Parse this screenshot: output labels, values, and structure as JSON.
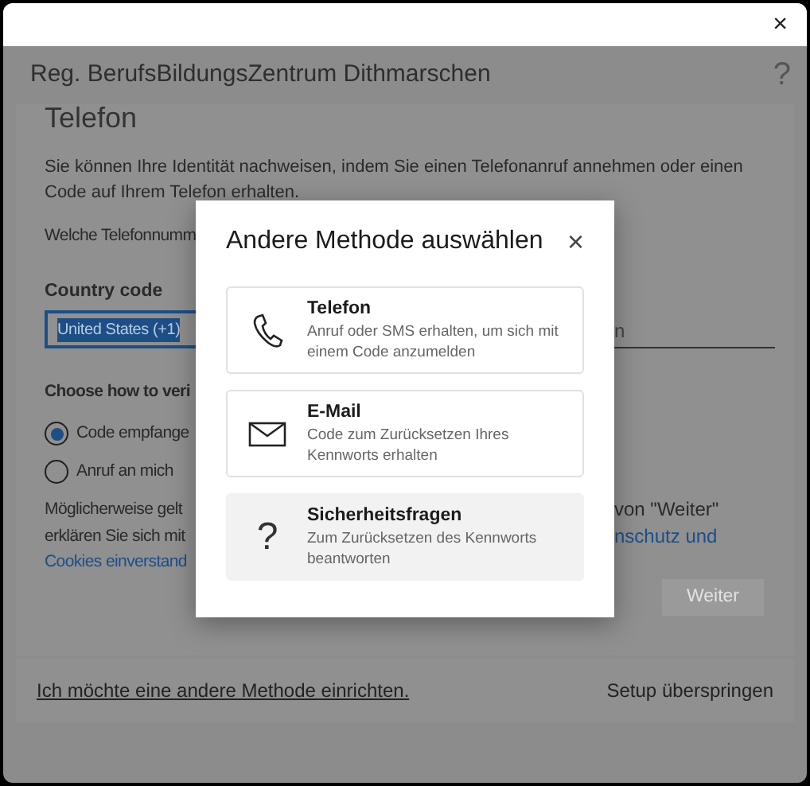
{
  "window": {
    "close": "×",
    "title": "Reg. BerufsBildungsZentrum Dithmarschen",
    "help": "?"
  },
  "page": {
    "heading": "Telefon",
    "intro": "Sie können Ihre Identität nachweisen, indem Sie einen Telefonanruf annehmen oder einen Code auf Ihrem Telefon erhalten.",
    "question": "Welche Telefonnumm",
    "country_label": "Country code",
    "country_value": "United States (+1)",
    "phone_placeholder": "n",
    "method_label": "Choose how to veri",
    "methods": [
      {
        "label": "Code empfange",
        "selected": true
      },
      {
        "label": "Anruf an mich",
        "selected": false
      }
    ],
    "notice_left": [
      {
        "text": "Möglicherweise gelt",
        "kind": "text"
      },
      {
        "text": "erklären Sie sich mit",
        "kind": "text"
      },
      {
        "text": "Cookies einverstand",
        "kind": "link"
      }
    ],
    "notice_right": [
      {
        "text": "von \"Weiter\"",
        "kind": "text"
      },
      {
        "text": "nschutz und",
        "kind": "link"
      }
    ],
    "next_button": {
      "label": "Weiter",
      "disabled": true
    }
  },
  "footer": {
    "link": "Ich möchte eine andere Methode einrichten.",
    "skip": "Setup überspringen"
  },
  "dialog": {
    "title": "Andere Methode auswählen",
    "close": "×",
    "options": [
      {
        "kind": "phone",
        "title": "Telefon",
        "description": "Anruf oder SMS erhalten, um sich mit einem Code anzumelden",
        "selected": false
      },
      {
        "kind": "email",
        "title": "E-Mail",
        "description": "Code zum Zurücksetzen Ihres Kennworts erhalten",
        "selected": false
      },
      {
        "kind": "questions",
        "symbol": "?",
        "title": "Sicherheitsfragen",
        "description": "Zum Zurücksetzen des Kennworts beantworten",
        "selected": true
      }
    ]
  }
}
